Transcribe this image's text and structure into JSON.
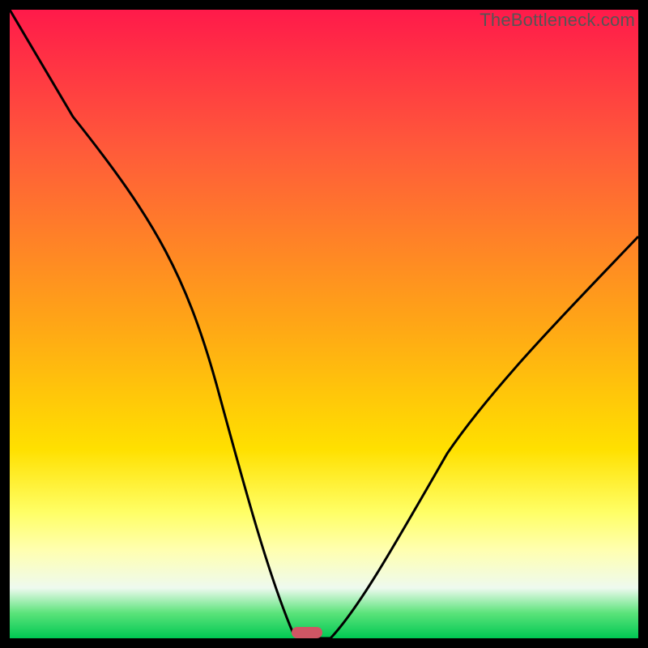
{
  "watermark": "TheBottleneck.com",
  "chart_data": {
    "type": "line",
    "title": "",
    "xlabel": "",
    "ylabel": "",
    "xlim": [
      0,
      100
    ],
    "ylim": [
      0,
      100
    ],
    "series": [
      {
        "name": "bottleneck-curve",
        "x": [
          0,
          10,
          20,
          30,
          40,
          43,
          45,
          50,
          55,
          60,
          70,
          80,
          90,
          100
        ],
        "values": [
          100,
          83,
          70,
          55,
          28,
          10,
          0,
          0,
          4,
          12,
          28,
          42,
          54,
          64
        ]
      }
    ],
    "annotations": [
      {
        "name": "min-marker",
        "x": 47,
        "y": 0
      }
    ],
    "gradient_background": {
      "top": "#ff1a4a",
      "bottom": "#00c853"
    }
  },
  "colors": {
    "curve": "#000000",
    "marker": "#cf5664",
    "frame": "#000000"
  }
}
